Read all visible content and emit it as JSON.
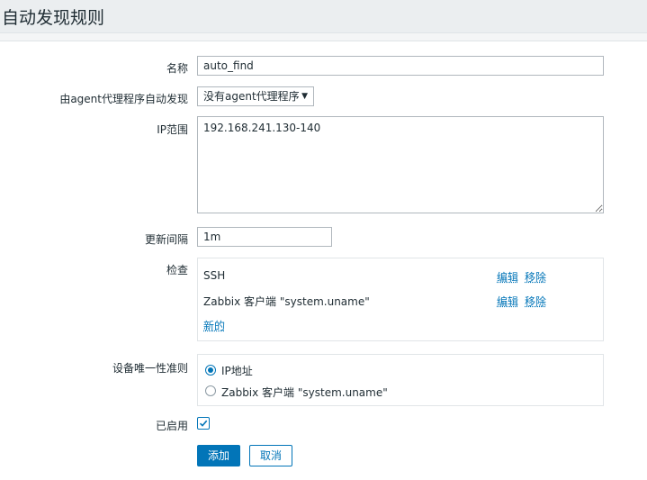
{
  "page": {
    "title": "自动发现规则"
  },
  "form": {
    "name": {
      "label": "名称",
      "value": "auto_find"
    },
    "proxy": {
      "label": "由agent代理程序自动发现",
      "value": "没有agent代理程序",
      "arrow": "▼"
    },
    "ip_range": {
      "label": "IP范围",
      "value": "192.168.241.130-140"
    },
    "interval": {
      "label": "更新间隔",
      "value": "1m"
    },
    "checks": {
      "label": "检查",
      "items": [
        {
          "text": "SSH",
          "edit": "编辑",
          "remove": "移除"
        },
        {
          "text": "Zabbix 客户端 \"system.uname\"",
          "edit": "编辑",
          "remove": "移除"
        }
      ],
      "new": "新的"
    },
    "uniqueness": {
      "label": "设备唯一性准则",
      "options": [
        {
          "text": "IP地址",
          "selected": true
        },
        {
          "text": "Zabbix 客户端 \"system.uname\"",
          "selected": false
        }
      ]
    },
    "enabled": {
      "label": "已启用",
      "checked": true
    }
  },
  "buttons": {
    "add": "添加",
    "cancel": "取消"
  },
  "colors": {
    "accent": "#0275b8",
    "header_bg": "#ebeef0",
    "page_bg": "#f4f5f6"
  }
}
